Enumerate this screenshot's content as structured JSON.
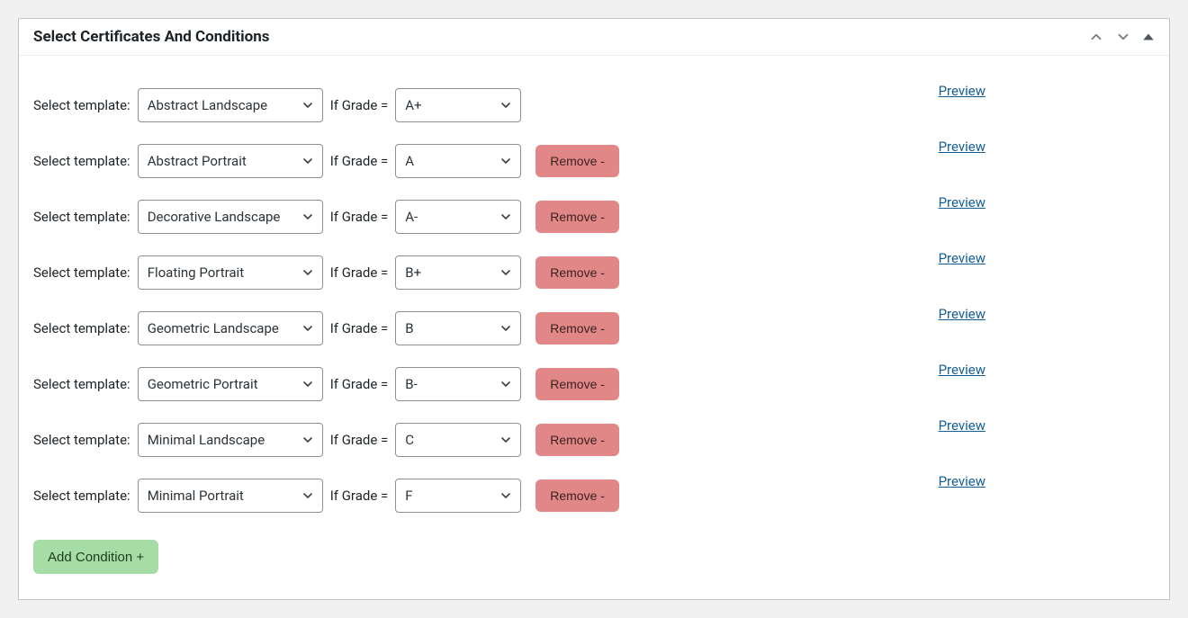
{
  "panel": {
    "title": "Select Certificates And Conditions"
  },
  "labels": {
    "select_template": "Select template:",
    "if_grade": "If Grade =",
    "preview": "Preview",
    "remove": "Remove -",
    "add_condition": "Add Condition +"
  },
  "rows": [
    {
      "template": "Abstract Landscape",
      "grade": "A+",
      "removable": false
    },
    {
      "template": "Abstract Portrait",
      "grade": "A",
      "removable": true
    },
    {
      "template": "Decorative Landscape",
      "grade": "A-",
      "removable": true
    },
    {
      "template": "Floating Portrait",
      "grade": "B+",
      "removable": true
    },
    {
      "template": "Geometric Landscape",
      "grade": "B",
      "removable": true
    },
    {
      "template": "Geometric Portrait",
      "grade": "B-",
      "removable": true
    },
    {
      "template": "Minimal Landscape",
      "grade": "C",
      "removable": true
    },
    {
      "template": "Minimal Portrait",
      "grade": "F",
      "removable": true
    }
  ]
}
